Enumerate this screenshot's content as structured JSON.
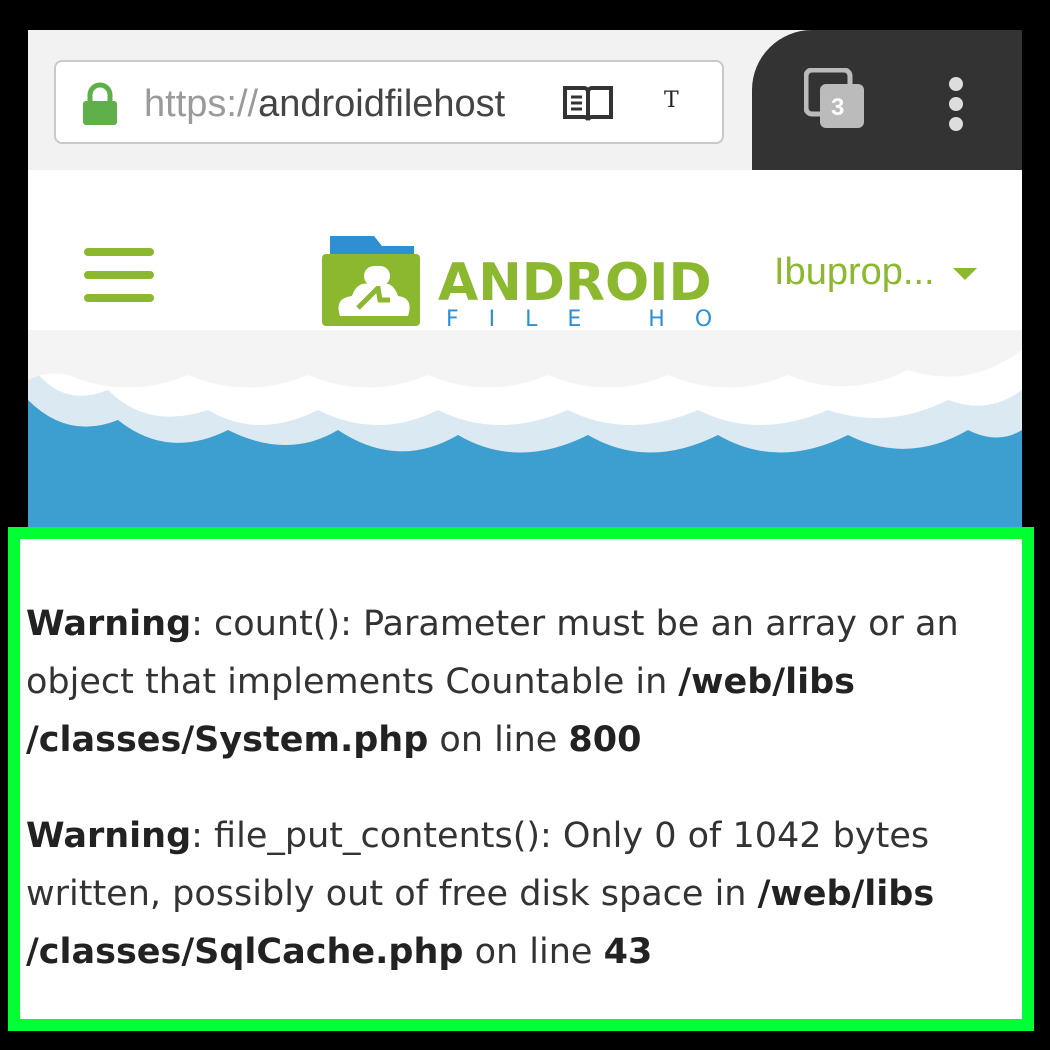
{
  "browser": {
    "url_scheme": "https://",
    "url_host": "androidfilehost",
    "t_char": "T",
    "tab_count": "3"
  },
  "site": {
    "logo_main": "ANDROID",
    "logo_sub": "FILE HOST",
    "user_menu": "Ibuprop...",
    "accent_color": "#8bb82f",
    "sky_color": "#3d9fd0"
  },
  "warnings": [
    {
      "label": "Warning",
      "message": ": count(): Parameter must be an array or an object that implements Countable in ",
      "path": "/web/libs /classes/System.php",
      "on_line": " on line ",
      "line": "800"
    },
    {
      "label": "Warning",
      "message": ": file_put_contents(): Only 0 of 1042 bytes written, possibly out of free disk space in ",
      "path": "/web/libs /classes/SqlCache.php",
      "on_line": " on line ",
      "line": "43"
    }
  ],
  "frame_color": "#00ff33"
}
